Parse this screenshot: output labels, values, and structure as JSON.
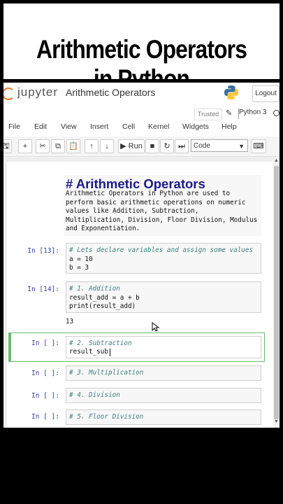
{
  "banner": {
    "title": "Arithmetic Operators in Python"
  },
  "header": {
    "logo_text": "jupyter",
    "notebook_title": "Arithmetic Operators",
    "logout_label": "Logout",
    "trusted_label": "Trusted",
    "kernel_name": "Python 3"
  },
  "menu": [
    "File",
    "Edit",
    "View",
    "Insert",
    "Cell",
    "Kernel",
    "Widgets",
    "Help"
  ],
  "toolbar": {
    "run_label": "Run",
    "cell_type": "Code"
  },
  "notebook": {
    "md_heading": "# Arithmetic Operators",
    "md_lines": [
      "Arithmetic Operators in Python are used to",
      "perform basic arithmetic operations on numeric",
      "values like Addition, Subtraction,",
      "Multiplication, Division, Floor Division, Modulus",
      "and Exponentiation."
    ],
    "cells": [
      {
        "prompt": "In [13]:",
        "lines": [
          "# Lets declare variables and assign some values",
          "a = 10",
          "b = 3"
        ]
      },
      {
        "prompt": "In [14]:",
        "lines": [
          "# 1. Addition",
          "result_add = a + b",
          "print(result_add)"
        ],
        "output": "13"
      },
      {
        "prompt": "In [ ]:",
        "lines": [
          "# 2. Subtraction",
          "result_sub "
        ]
      },
      {
        "prompt": "In [ ]:",
        "lines": [
          "# 3. Multiplication"
        ]
      },
      {
        "prompt": "In [ ]:",
        "lines": [
          "# 4. Division"
        ]
      },
      {
        "prompt": "In [ ]:",
        "lines": [
          "# 5. Floor Division"
        ]
      }
    ]
  },
  "colors": {
    "selected_border": "#66bb6a",
    "prompt": "#303f9f",
    "heading": "#1a1a8c",
    "comment": "#408080"
  }
}
